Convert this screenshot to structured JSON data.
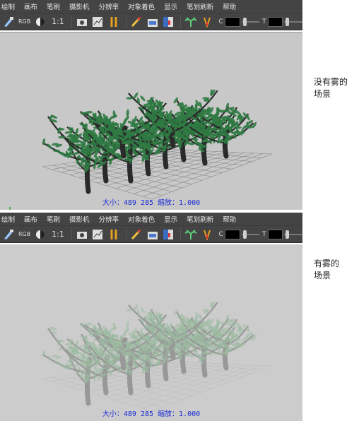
{
  "menu": [
    "绘制",
    "画布",
    "笔刷",
    "摄影机",
    "分辨率",
    "对象着色",
    "显示",
    "笔划刷新",
    "帮助"
  ],
  "toolbar": {
    "rgb_label": "RGB",
    "ratio_label": "1:1",
    "c_label": "C",
    "t_label": "T"
  },
  "panels": [
    {
      "status": "大小：489 285 缩放：1.000",
      "caption_line1": "没有雾的",
      "caption_line2": "场景"
    },
    {
      "status": "大小：489 285 缩放：1.000",
      "caption_line1": "有雾的",
      "caption_line2": "场景"
    }
  ],
  "colors": {
    "toolbar_bg": "#444444",
    "viewport_bg": "#c8c8c8",
    "hud_text": "#1a2bd6",
    "foliage": "#2f7a43",
    "trunk": "#2a2a2a"
  },
  "icons": [
    "paint-brush-icon",
    "rgb-channel-icon",
    "contrast-icon",
    "camera-icon",
    "graph-icon",
    "split-icon",
    "brush-stroke-icon",
    "canvas-icon",
    "wipe-icon",
    "tree-icon",
    "fork-icon"
  ]
}
